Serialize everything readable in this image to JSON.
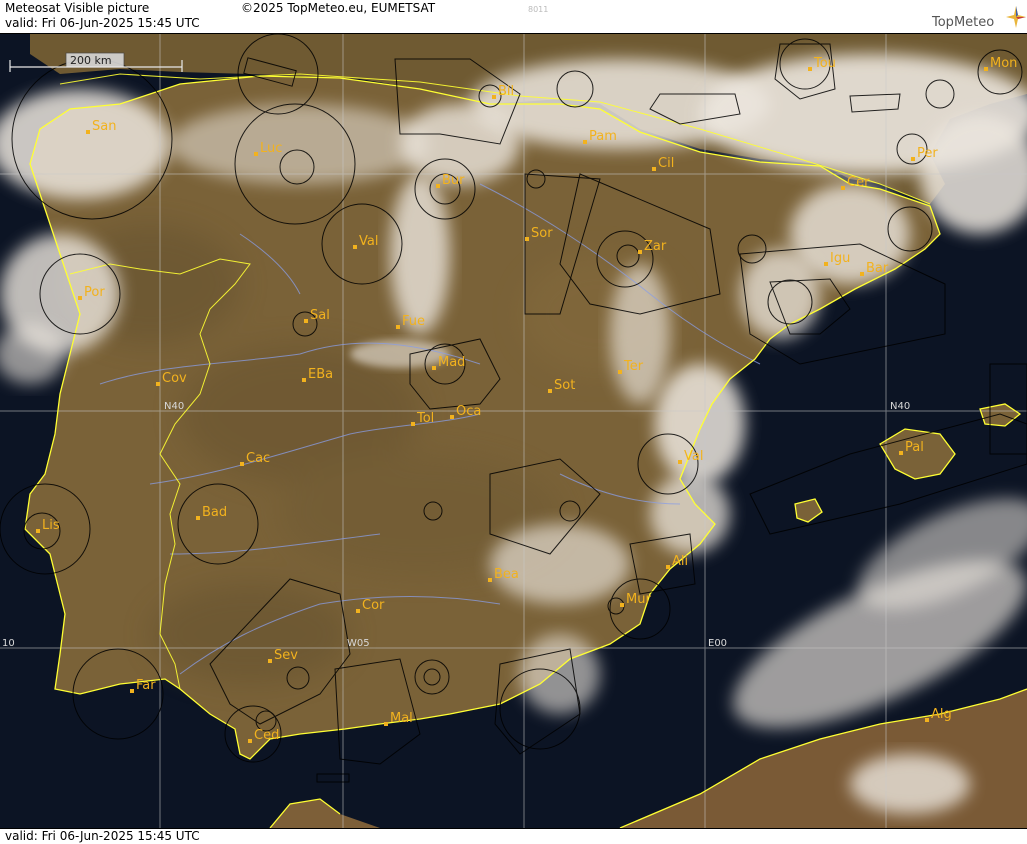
{
  "header": {
    "title": "Meteosat Visible picture",
    "copyright": "©2025 TopMeteo.eu, EUMETSAT",
    "valid": "valid:  Fri  06-Jun-2025  15:45 UTC",
    "frame_id": "8011",
    "logo": "TopMeteo"
  },
  "footer": {
    "valid": "valid:  Fri  06-Jun-2025  15:45 UTC"
  },
  "scale_bar": {
    "label": "200 km"
  },
  "grid_labels": {
    "n40_left": "N40",
    "n40_right": "N40",
    "w10": "10",
    "w05": "W05",
    "e00": "E00"
  },
  "cities": [
    {
      "code": "San"
    },
    {
      "code": "Luc"
    },
    {
      "code": "Bur"
    },
    {
      "code": "Bil"
    },
    {
      "code": "Pam"
    },
    {
      "code": "Cil"
    },
    {
      "code": "Tou"
    },
    {
      "code": "Mon"
    },
    {
      "code": "Per"
    },
    {
      "code": "Cer"
    },
    {
      "code": "Val"
    },
    {
      "code": "Sor"
    },
    {
      "code": "Zar"
    },
    {
      "code": "Igu"
    },
    {
      "code": "Bar"
    },
    {
      "code": "Por"
    },
    {
      "code": "Sal"
    },
    {
      "code": "Fue"
    },
    {
      "code": "Mad"
    },
    {
      "code": "EBa"
    },
    {
      "code": "Cov"
    },
    {
      "code": "Tol"
    },
    {
      "code": "Oca"
    },
    {
      "code": "Sot"
    },
    {
      "code": "Ter"
    },
    {
      "code": "Cac"
    },
    {
      "code": "Val"
    },
    {
      "code": "Pal"
    },
    {
      "code": "Bad"
    },
    {
      "code": "Lis"
    },
    {
      "code": "Ali"
    },
    {
      "code": "Bea"
    },
    {
      "code": "Cor"
    },
    {
      "code": "Mur"
    },
    {
      "code": "Sev"
    },
    {
      "code": "Far"
    },
    {
      "code": "Mal"
    },
    {
      "code": "Ced"
    },
    {
      "code": "Alg"
    }
  ],
  "colors": {
    "land": "#7a6238",
    "sea": "#0c1424",
    "cloud": "#ece6de",
    "coast": "#ffff33",
    "city": "#f2b21e",
    "river": "#8a9ee6"
  }
}
